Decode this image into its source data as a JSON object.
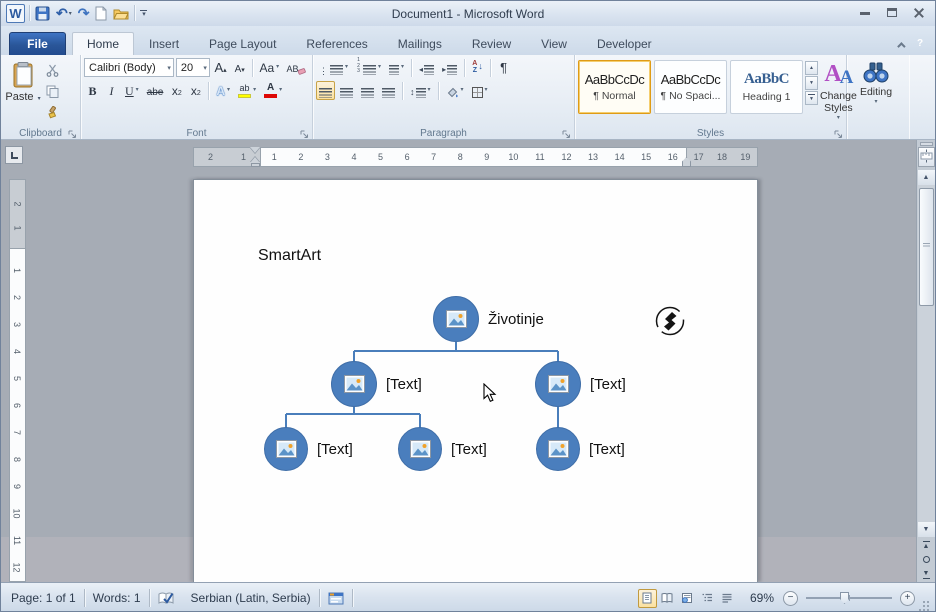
{
  "window": {
    "title": "Document1  -  Microsoft Word"
  },
  "glyphs": {
    "word": "W",
    "undo": "↶",
    "redo": "↷",
    "dropdown": "▾",
    "qat_more": "▾",
    "help": "?",
    "scroll_up": "▲",
    "scroll_down": "▼",
    "browse_prev": "▲",
    "browse_next": "▼",
    "zoom_minus": "−",
    "zoom_plus": "+"
  },
  "tabs": {
    "file": "File",
    "items": [
      "Home",
      "Insert",
      "Page Layout",
      "References",
      "Mailings",
      "Review",
      "View",
      "Developer"
    ]
  },
  "ribbon": {
    "clipboard": {
      "label": "Clipboard",
      "paste": "Paste"
    },
    "font": {
      "label": "Font",
      "name": "Calibri (Body)",
      "size": "20",
      "glyphs": {
        "grow": "A",
        "grow_arrow": "▴",
        "shrink": "A",
        "shrink_arrow": "▾",
        "case": "Aa",
        "clear": "AB",
        "bold": "B",
        "italic": "I",
        "underline": "U",
        "strike": "abe",
        "sub_base": "x",
        "sub_script": "2",
        "sup_base": "x",
        "sup_script": "2",
        "effects": "A",
        "highlight": "ab",
        "color": "A"
      }
    },
    "paragraph": {
      "label": "Paragraph",
      "glyphs": {
        "bullets": "⋮",
        "numbers": "123",
        "outdent": "◂",
        "indent": "▸",
        "sort_a": "A",
        "sort_z": "Z",
        "sort_arrow": "↓",
        "pilcrow": "¶",
        "spacing": "↕"
      }
    },
    "styles": {
      "label": "Styles",
      "items": [
        {
          "preview": "AaBbCcDc",
          "name": "¶ Normal"
        },
        {
          "preview": "AaBbCcDc",
          "name": "¶ No Spaci..."
        },
        {
          "preview": "AaBbC",
          "name": "Heading 1"
        }
      ],
      "change_styles": "Change Styles",
      "icon_a1": "A",
      "icon_a2": "A"
    },
    "editing": {
      "label": "Editing"
    }
  },
  "ruler": {
    "h_margin": [
      "2",
      "1"
    ],
    "h_main": [
      "1",
      "2",
      "3",
      "4",
      "5",
      "6",
      "7",
      "8",
      "9",
      "10",
      "11",
      "12",
      "13",
      "14",
      "15",
      "16"
    ],
    "h_right": [
      "17",
      "18",
      "19"
    ],
    "v_margin": [
      "2",
      "1"
    ],
    "v_main": [
      "1",
      "2",
      "3",
      "4",
      "5",
      "6",
      "7",
      "8",
      "9",
      "10",
      "11",
      "12"
    ]
  },
  "document": {
    "heading": "SmartArt",
    "diagram": {
      "root_label": "Životinje",
      "placeholder_label": "[Text]"
    }
  },
  "status": {
    "page": "Page: 1 of 1",
    "words": "Words: 1",
    "language": "Serbian (Latin, Serbia)",
    "zoom_level": "69%"
  },
  "colors": {
    "node_blue": "#4A7EBD",
    "connector_blue": "#4A7EBB",
    "file_tab_blue": "#2C5AA0",
    "active_selection_orange": "#FBE1A0",
    "highlight_yellow": "#FFFF00",
    "font_color_red": "#DD0806",
    "heading_style_blue": "#365F91"
  }
}
